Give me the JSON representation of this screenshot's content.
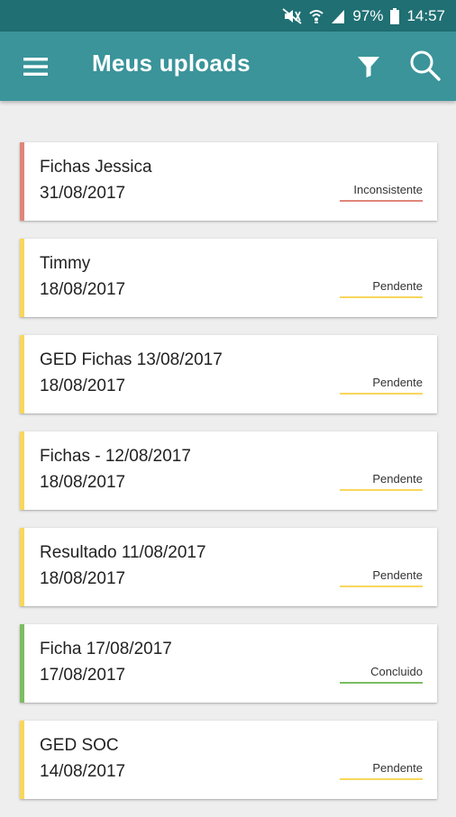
{
  "status_bar": {
    "battery": "97%",
    "time": "14:57"
  },
  "app_bar": {
    "title": "Meus uploads",
    "icons": [
      "menu-icon",
      "filter-icon",
      "search-icon"
    ]
  },
  "colors": {
    "status_bar_bg": "#1f6f73",
    "app_bar_bg": "#3a949a",
    "inconsistente": "#e08579",
    "pendente": "#f8d75b",
    "concluido": "#7bbd62"
  },
  "uploads": [
    {
      "name": "Fichas Jessica",
      "date": "31/08/2017",
      "status": "Inconsistente"
    },
    {
      "name": "Timmy",
      "date": "18/08/2017",
      "status": "Pendente"
    },
    {
      "name": "GED Fichas 13/08/2017",
      "date": "18/08/2017",
      "status": "Pendente"
    },
    {
      "name": "Fichas - 12/08/2017",
      "date": "18/08/2017",
      "status": "Pendente"
    },
    {
      "name": "Resultado 11/08/2017",
      "date": "18/08/2017",
      "status": "Pendente"
    },
    {
      "name": "Ficha 17/08/2017",
      "date": "17/08/2017",
      "status": "Concluido"
    },
    {
      "name": "GED SOC",
      "date": "14/08/2017",
      "status": "Pendente"
    }
  ]
}
